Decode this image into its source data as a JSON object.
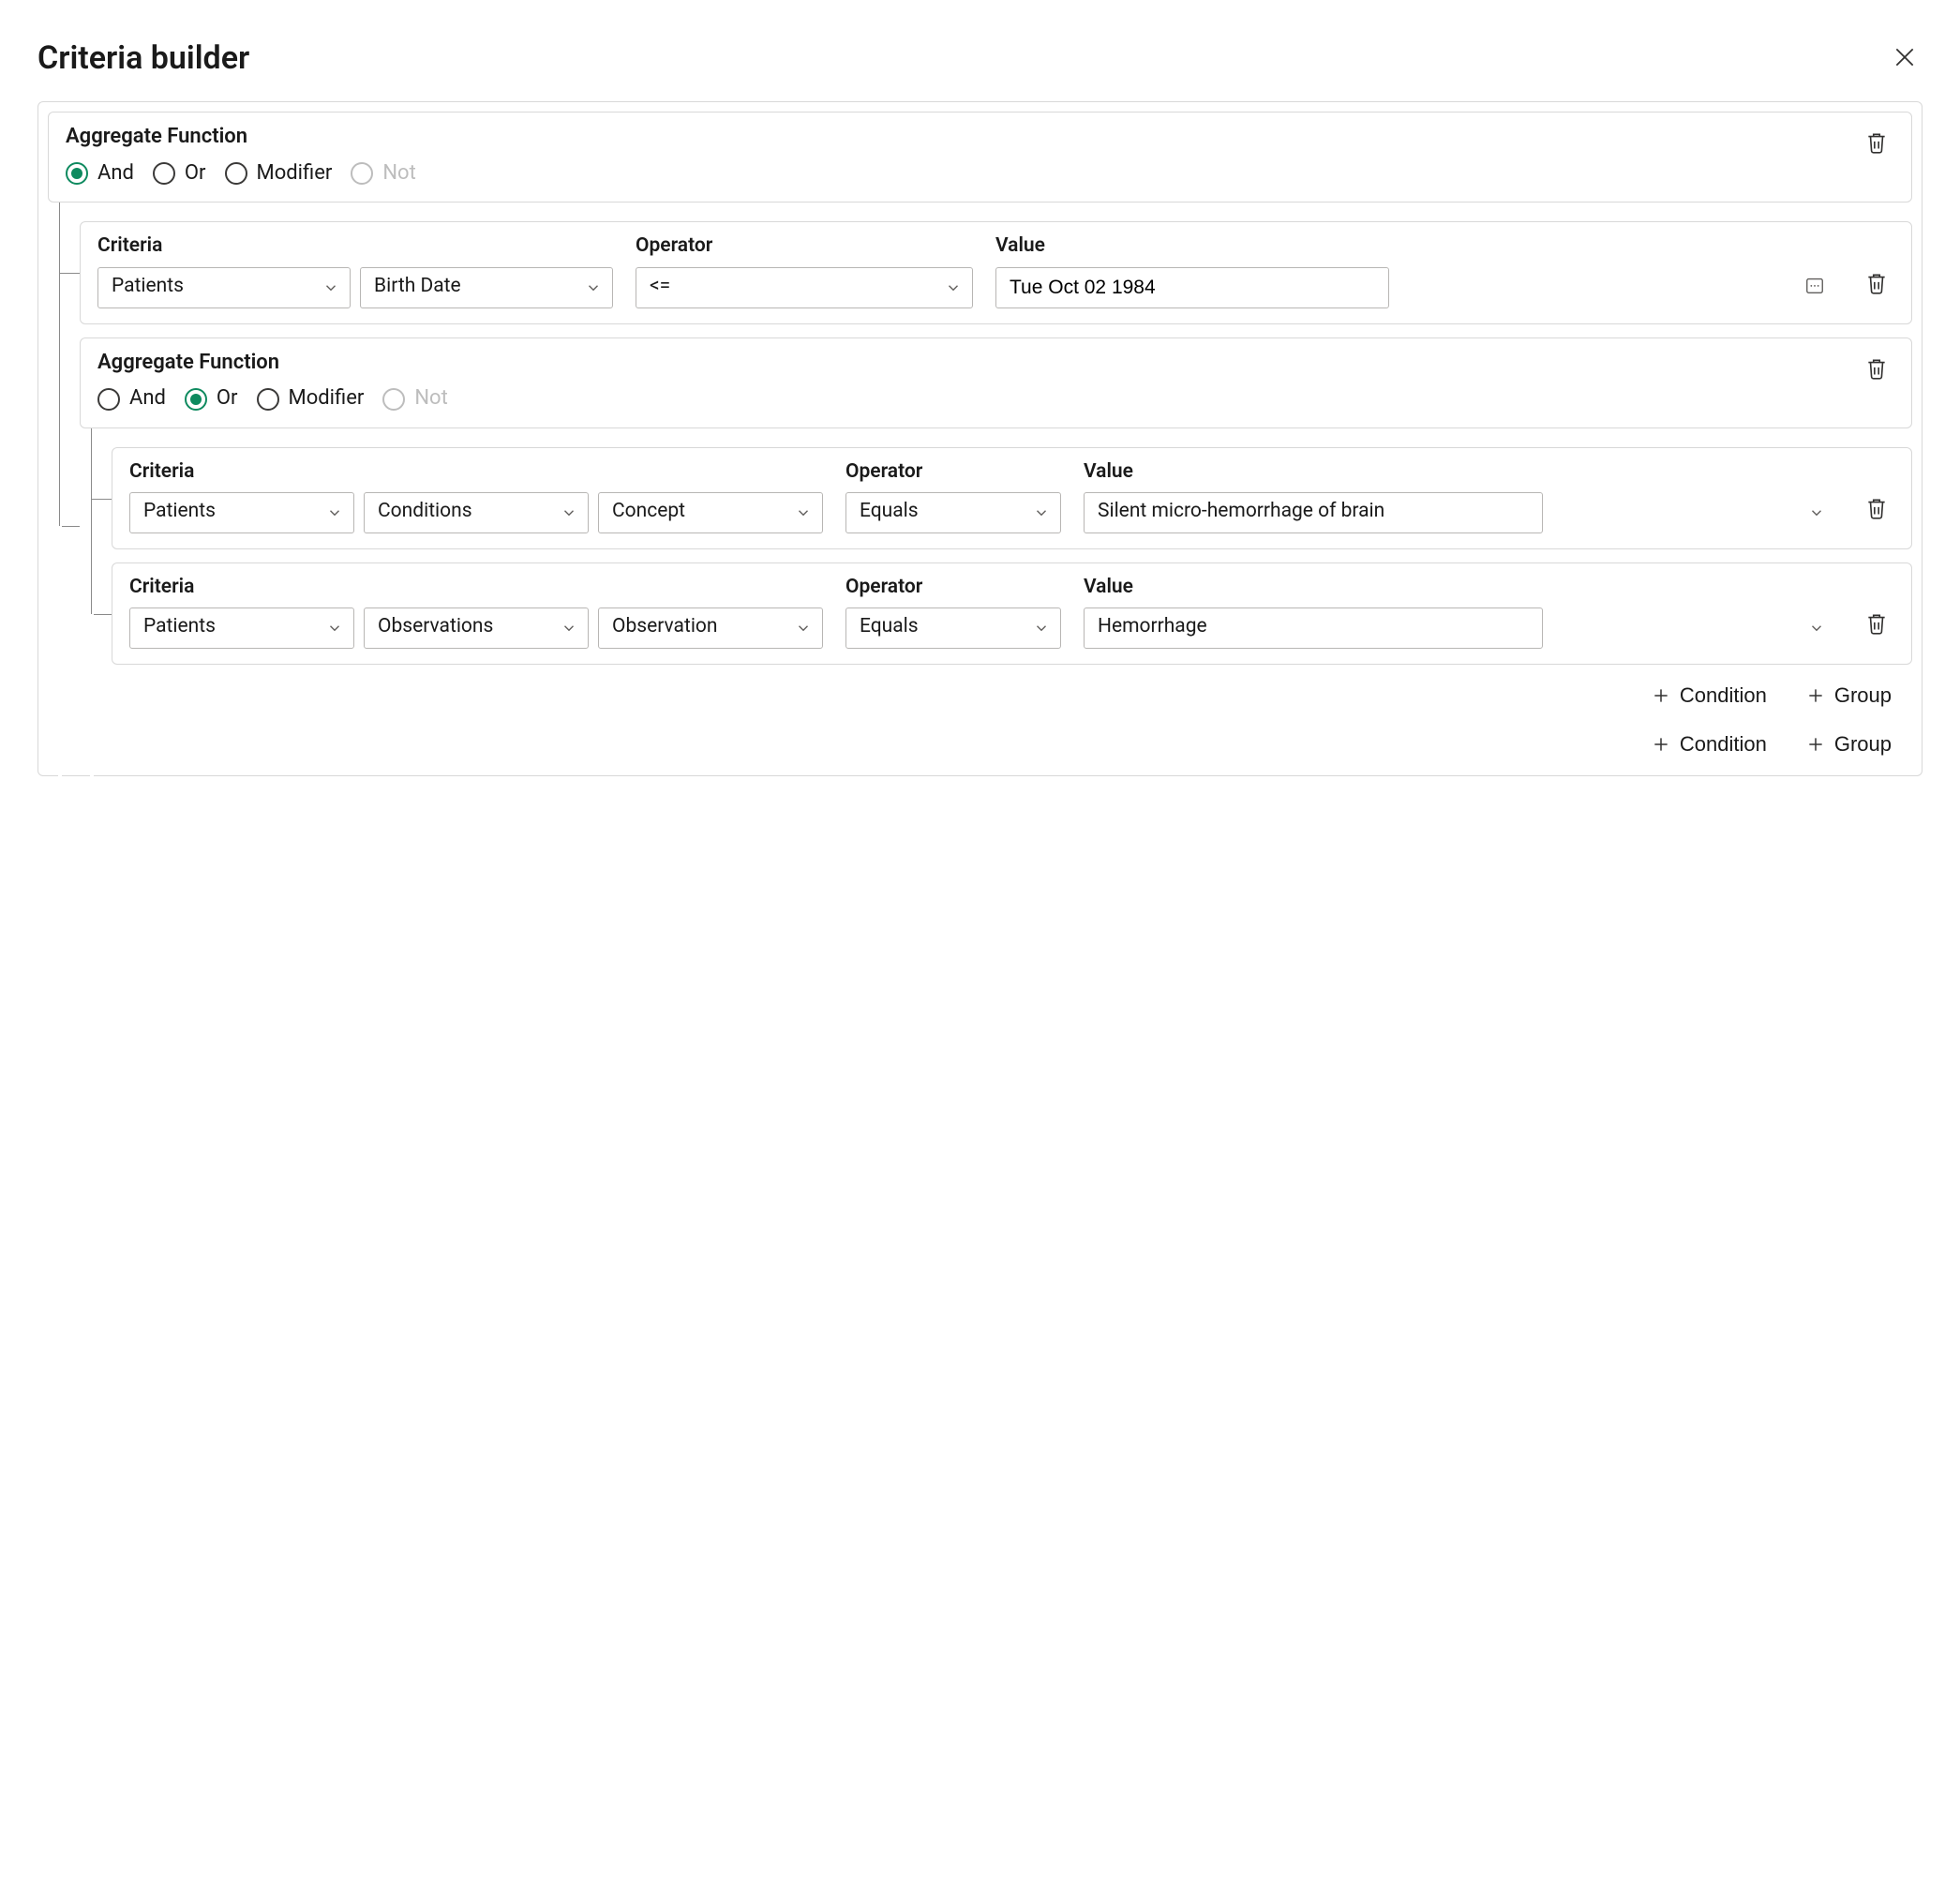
{
  "title": "Criteria builder",
  "labels": {
    "aggregate_function": "Aggregate Function",
    "criteria": "Criteria",
    "operator": "Operator",
    "value": "Value",
    "and": "And",
    "or": "Or",
    "modifier": "Modifier",
    "not": "Not",
    "add_condition": "Condition",
    "add_group": "Group"
  },
  "root_group": {
    "selected_operator": "And",
    "rows": [
      {
        "type": "condition",
        "criteria_path": [
          "Patients",
          "Birth Date"
        ],
        "operator": "<=",
        "value_type": "date",
        "value": "Tue Oct 02 1984"
      },
      {
        "type": "group",
        "selected_operator": "Or",
        "rows": [
          {
            "type": "condition",
            "criteria_path": [
              "Patients",
              "Conditions",
              "Concept"
            ],
            "operator": "Equals",
            "value_type": "lookup",
            "value": "Silent micro-hemorrhage of brain"
          },
          {
            "type": "condition",
            "criteria_path": [
              "Patients",
              "Observations",
              "Observation"
            ],
            "operator": "Equals",
            "value_type": "lookup",
            "value": "Hemorrhage"
          }
        ]
      }
    ]
  }
}
